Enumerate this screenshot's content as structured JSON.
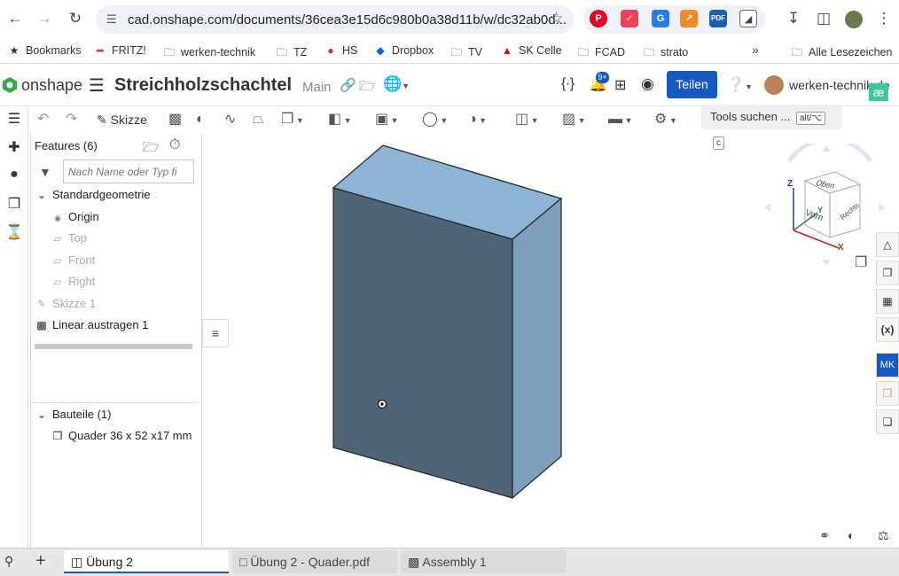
{
  "browser": {
    "url": "cad.onshape.com/documents/36cea3e15d6c980b0a38d11b/w/dc32ab0d...",
    "bookmarks": [
      "Bookmarks",
      "FRITZ!",
      "werken-technik",
      "TZ",
      "HS",
      "Dropbox",
      "TV",
      "SK Celle",
      "FCAD",
      "strato"
    ],
    "all_bookmarks": "Alle Lesezeichen",
    "more": "»"
  },
  "app": {
    "logo": "onshape",
    "doc_title": "Streichholzschachtel",
    "branch": "Main",
    "notif_badge": "9+",
    "share_label": "Teilen",
    "user": "werken-technik.de",
    "account_badge": "æ"
  },
  "toolbar": {
    "sketch_label": "Skizze",
    "tools_search": "Tools suchen ...",
    "kbd1": "alt/⌥",
    "kbd2": "c"
  },
  "features": {
    "title": "Features (6)",
    "filter_placeholder": "Nach Name oder Typ fi",
    "group": "Standardgeometrie",
    "origin": "Origin",
    "planes": [
      "Top",
      "Front",
      "Right"
    ],
    "sketch": "Skizze 1",
    "extrude": "Linear austragen 1",
    "parts_group": "Bauteile (1)",
    "part": "Quader 36 x 52 x17 mm"
  },
  "viewcube": {
    "top": "Oben",
    "front": "Vorn",
    "right": "Rechts",
    "axis_x": "X",
    "axis_y": "Y",
    "axis_z": "Z"
  },
  "rightrail": {
    "mkt": "MK"
  },
  "tabs": [
    "Übung 2",
    "Übung 2 - Quader.pdf",
    "Assembly 1"
  ],
  "colors": {
    "box_front": "#4f6577",
    "box_top": "#8db4d4",
    "box_side": "#7d9fb9",
    "accent": "#1559c1"
  }
}
